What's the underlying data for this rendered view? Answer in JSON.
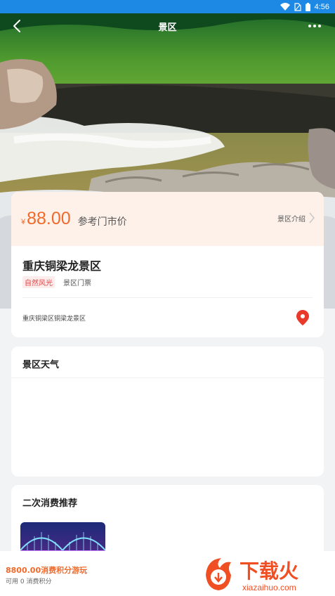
{
  "status_bar": {
    "time": "4:56"
  },
  "nav": {
    "title": "景区"
  },
  "price_card": {
    "currency": "¥",
    "price": "88.00",
    "price_label": "参考门市价",
    "intro_label": "景区介绍",
    "scenic_name": "重庆铜梁龙景区",
    "tags": [
      "自然风光",
      "景区门票"
    ],
    "address": "重庆铜梁区铜梁龙景区"
  },
  "weather_card": {
    "title": "景区天气"
  },
  "recommend_card": {
    "title": "二次消费推荐"
  },
  "bottom_bar": {
    "points_title": "8800.00消费积分游玩",
    "points_sub": "可用 0 消费积分"
  },
  "watermark": {
    "text": "下载火",
    "domain": "xiazaihuo.com"
  },
  "colors": {
    "accent": "#f06a2b",
    "status_bar": "#1e88e5",
    "tag_red": "#e84343"
  }
}
